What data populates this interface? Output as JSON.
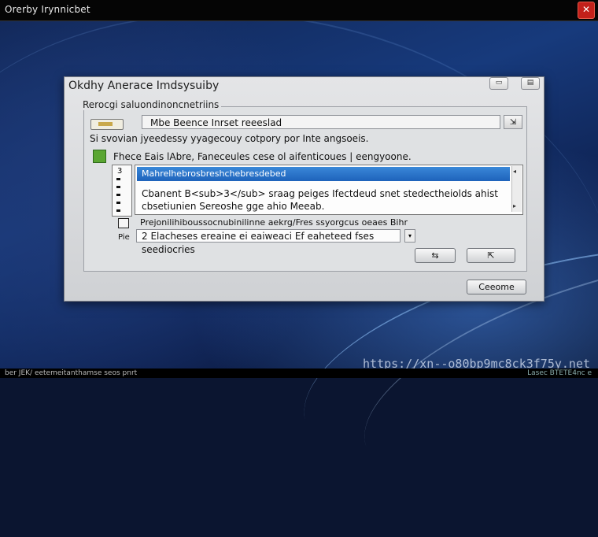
{
  "window": {
    "title": "Orerby Irynnicbet",
    "close_glyph": "✕"
  },
  "dialog": {
    "title": "Okdhy Anerace Imdsysuiby",
    "group_label": "Rerocgi saluondinoncnetriins",
    "path_value": "Mbe Beence Inrset reeeslad",
    "path_button_icon": "⇲",
    "hint_text": "Si svovian jyeedessy yyagecouy cotpory por Inte angsoeis.",
    "checkbox_label": "Fhece Eais lAbre, Faneceules cese ol aifenticoues | eengyoone.",
    "list": {
      "gutter_number": "3",
      "selected_row": "Mahrelhebrosbreshchebresdebed",
      "body_line1": "Cbanent  B<sub>3</sub> sraag peiges Ifectdeud  snet stedectheiolds ahist",
      "body_line2": "cbsetiunien  Sereoshe  gge  ahio  Meeab."
    },
    "status_line": "Prejonilihiboussocnubinilinne aekrg/Fres ssyorgcus oeaes Bihr",
    "side_label": "Pie",
    "desc_value": "2 Elacheses  ereaine  ei eaiweaci  Ef  eaheteed  fses  seediocries",
    "buttons": {
      "button_a": "⇆",
      "button_b": "⇱",
      "close": "Ceeome"
    }
  },
  "taskbar": {
    "left": "ber JEK/ eetemeitanthamse seos pnrt",
    "right": "Lasec BTETE4nc e"
  },
  "watermark": "https://xn--o80bp9mc8ck3f75y.net",
  "colors": {
    "selection": "#2a74c9",
    "checkbox": "#5aa632",
    "close_button": "#c3201a"
  }
}
